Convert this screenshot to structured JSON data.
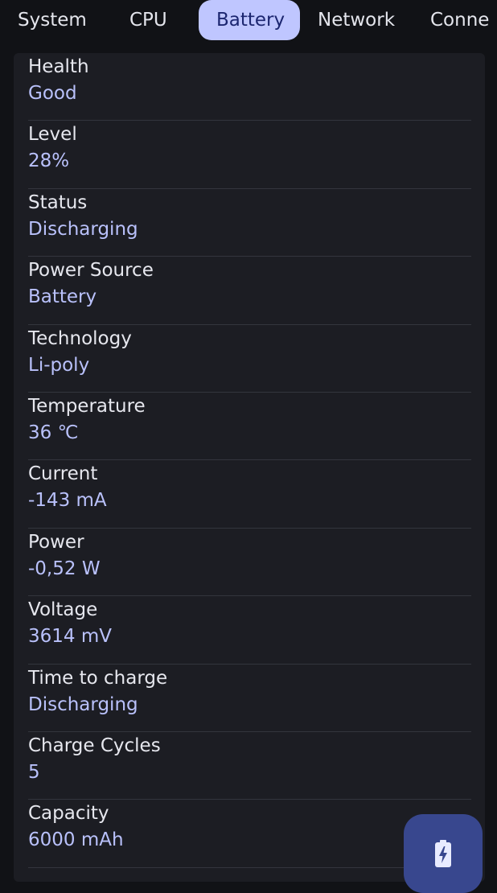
{
  "tabs": [
    {
      "label": "System"
    },
    {
      "label": "CPU"
    },
    {
      "label": "Battery"
    },
    {
      "label": "Network"
    },
    {
      "label": "Conne"
    }
  ],
  "active_tab": "Battery",
  "battery": {
    "rows": [
      {
        "label": "Health",
        "value": "Good"
      },
      {
        "label": "Level",
        "value": "28%"
      },
      {
        "label": "Status",
        "value": "Discharging"
      },
      {
        "label": "Power Source",
        "value": "Battery"
      },
      {
        "label": "Technology",
        "value": "Li-poly"
      },
      {
        "label": "Temperature",
        "value": "36 ℃"
      },
      {
        "label": "Current",
        "value": "-143 mA"
      },
      {
        "label": "Power",
        "value": "-0,52 W"
      },
      {
        "label": "Voltage",
        "value": "3614 mV"
      },
      {
        "label": "Time to charge",
        "value": "Discharging"
      },
      {
        "label": "Charge Cycles",
        "value": "5"
      },
      {
        "label": "Capacity",
        "value": "6000 mAh"
      }
    ]
  },
  "fab": {
    "icon": "battery-charging-icon"
  },
  "colors": {
    "background": "#111216",
    "card": "#1c1d23",
    "active_tab_bg": "#bfc6ff",
    "active_tab_text": "#1c2670",
    "value_text": "#b9c1fb",
    "fab": "#38478e"
  }
}
